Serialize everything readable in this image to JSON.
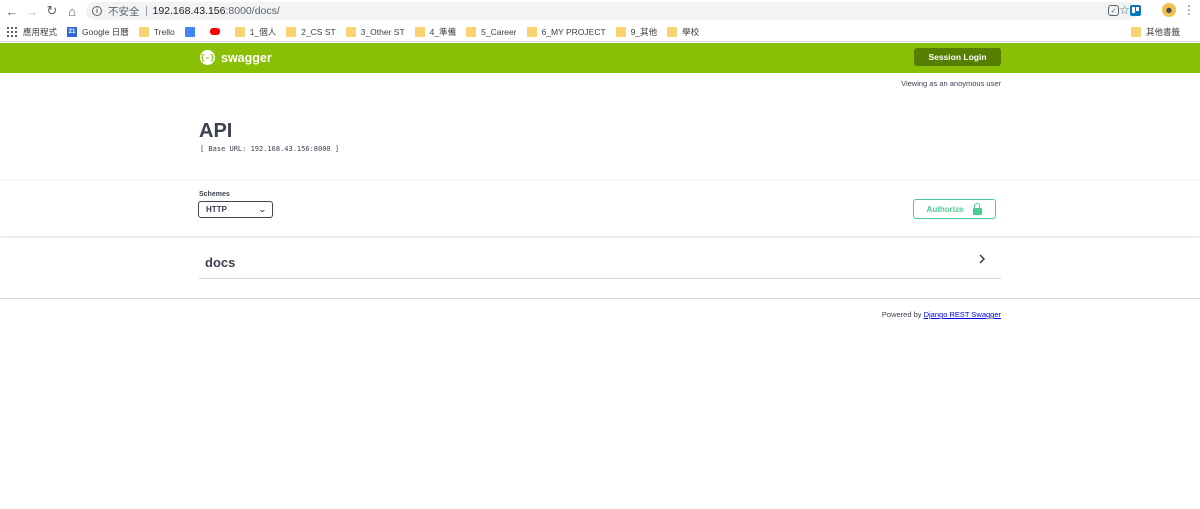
{
  "browser": {
    "security_label": "不安全",
    "url_host": "192.168.43.156",
    "url_path": ":8000/docs/",
    "bookmarks": [
      {
        "label": "應用程式",
        "icon": "apps-icon"
      },
      {
        "label": "Google 日曆",
        "icon": "google-calendar-icon"
      },
      {
        "label": "Trello",
        "icon": "folder-icon"
      },
      {
        "label": "",
        "icon": "google-docs-icon"
      },
      {
        "label": "",
        "icon": "youtube-icon"
      },
      {
        "label": "1_個人",
        "icon": "folder-icon"
      },
      {
        "label": "2_CS ST",
        "icon": "folder-icon"
      },
      {
        "label": "3_Other ST",
        "icon": "folder-icon"
      },
      {
        "label": "4_準備",
        "icon": "folder-icon"
      },
      {
        "label": "5_Career",
        "icon": "folder-icon"
      },
      {
        "label": "6_MY PROJECT",
        "icon": "folder-icon"
      },
      {
        "label": "9_其他",
        "icon": "folder-icon"
      },
      {
        "label": "學校",
        "icon": "folder-icon"
      }
    ],
    "other_bookmarks": "其他書籤",
    "gcal_badge": "21"
  },
  "header": {
    "logo_text": "swagger",
    "logo_icon": "{-}",
    "session_login": "Session Login",
    "accent": "#89bf04"
  },
  "viewing_text": "Viewing as an anoymous user",
  "api": {
    "title": "API",
    "base_url": "[ Base URL: 192.168.43.156:8000 ]"
  },
  "schemes": {
    "label": "Schemes",
    "selected": "HTTP"
  },
  "authorize": {
    "label": "Authorize",
    "color": "#49cc90"
  },
  "tags": [
    {
      "name": "docs"
    }
  ],
  "footer": {
    "powered_by": "Powered by",
    "link_text": "Django REST Swagger"
  }
}
